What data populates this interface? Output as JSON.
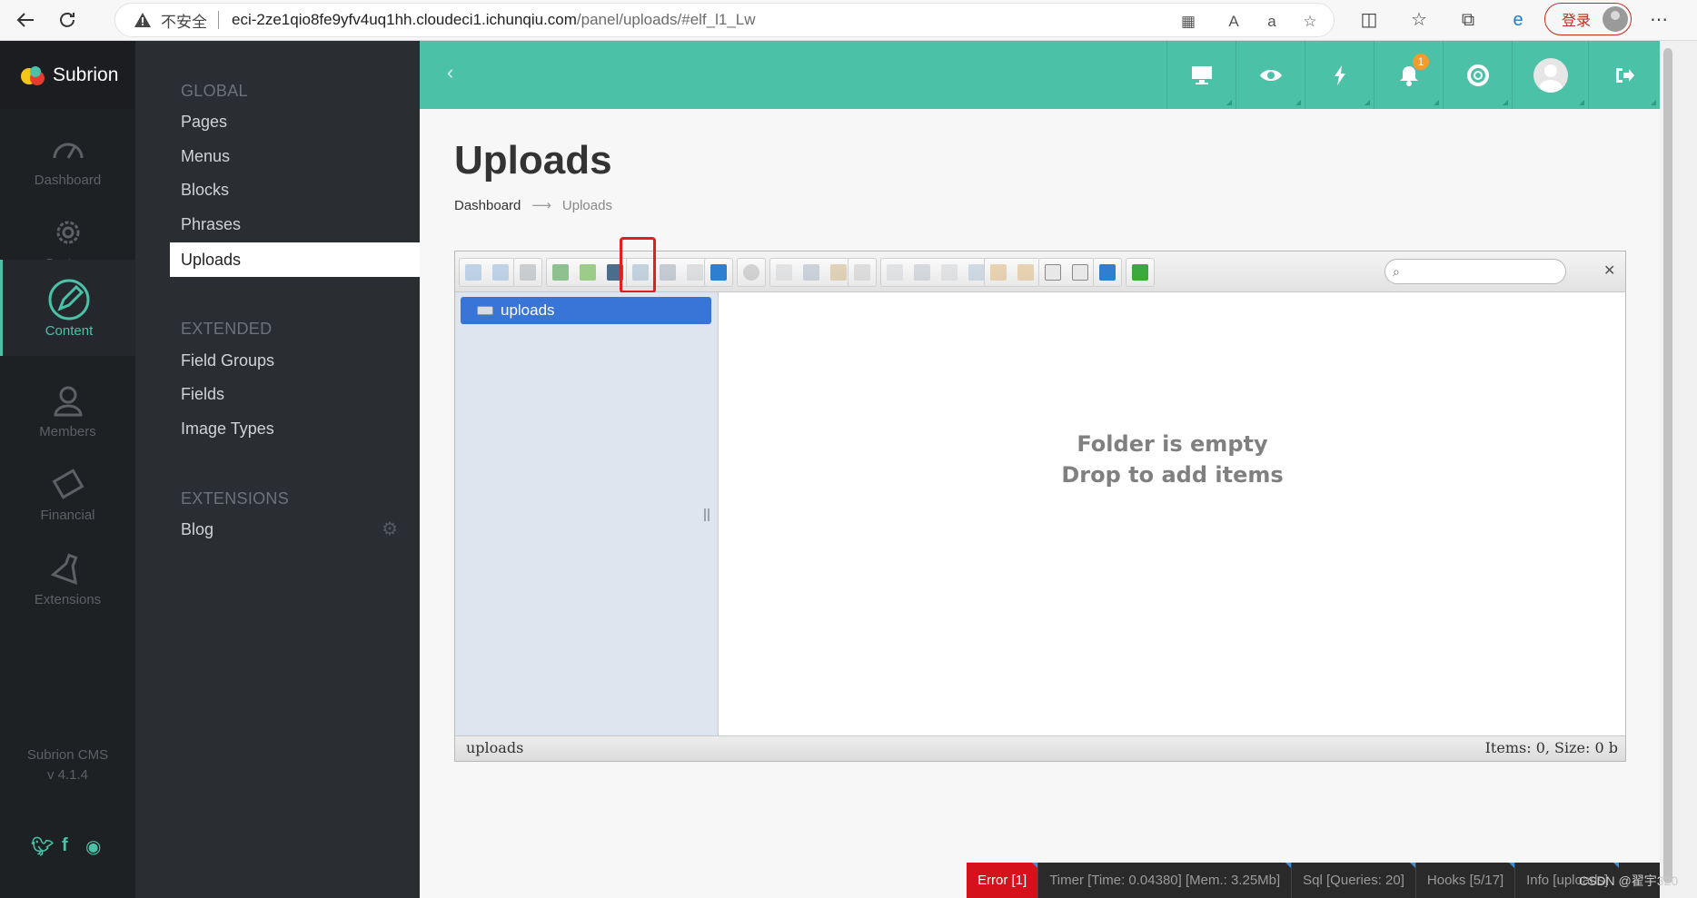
{
  "browser": {
    "insecure_label": "不安全",
    "url_host": "eci-2ze1qio8fe9yfv4uq1hh.cloudeci1.ichunqiu.com",
    "url_path": "/panel/uploads/#elf_l1_Lw",
    "login_label": "登录"
  },
  "brand": {
    "name": "Subrion"
  },
  "icon_sidebar": {
    "items": [
      {
        "label": "Dashboard",
        "icon": "gauge-icon"
      },
      {
        "label": "System",
        "icon": "gear-icon"
      },
      {
        "label": "Content",
        "icon": "pencil-icon"
      },
      {
        "label": "Members",
        "icon": "user-icon"
      },
      {
        "label": "Financial",
        "icon": "money-icon"
      },
      {
        "label": "Extensions",
        "icon": "flask-icon"
      }
    ],
    "version_line1": "Subrion CMS",
    "version_line2": "v 4.1.4"
  },
  "submenu": {
    "global_heading": "GLOBAL",
    "global_items": [
      "Pages",
      "Menus",
      "Blocks",
      "Phrases",
      "Uploads"
    ],
    "extended_heading": "EXTENDED",
    "extended_items": [
      "Field Groups",
      "Fields",
      "Image Types"
    ],
    "extensions_heading": "EXTENSIONS",
    "extensions_items": [
      "Blog"
    ]
  },
  "topbar": {
    "notification_count": "1"
  },
  "page": {
    "title": "Uploads",
    "breadcrumb_home": "Dashboard",
    "breadcrumb_arrow": "⟶",
    "breadcrumb_current": "Uploads"
  },
  "elfinder": {
    "tree_root": "uploads",
    "empty_line1": "Folder is empty",
    "empty_line2": "Drop to add items",
    "status_path": "uploads",
    "status_items": "Items: 0, Size: 0 b"
  },
  "debugbar": {
    "error": "Error [1]",
    "timer": "Timer [Time: 0.04380] [Mem.: 3.25Mb]",
    "sql": "Sql [Queries: 20]",
    "hooks": "Hooks [5/17]",
    "info": "Info [uploads]"
  },
  "watermark": "CSDN @翟宇320",
  "colors": {
    "accent": "#4bc1a7",
    "sidebar": "#1e2124",
    "submenu": "#2a2e33",
    "error": "#d5121b"
  }
}
